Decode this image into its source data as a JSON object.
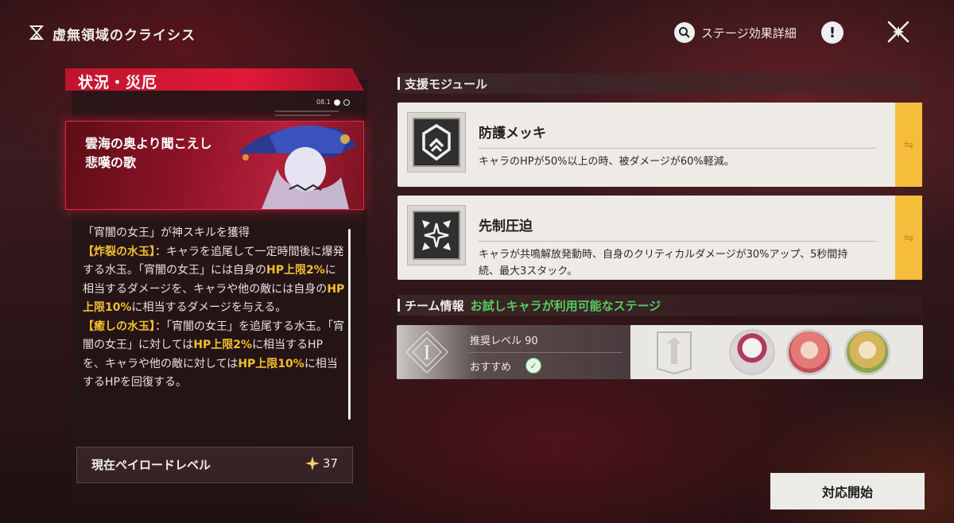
{
  "header": {
    "mode_title": "虚無領域のクライシス",
    "detail_label": "ステージ効果詳細",
    "alert_glyph": "!",
    "icons": {
      "logo": "hourglass-logo-icon",
      "search": "search-icon",
      "alert": "alert-icon",
      "close": "close-icon"
    }
  },
  "left": {
    "section_title": "状況・災厄",
    "stage_number": "08.1",
    "stage_title": "雲海の奥より聞こえし悲嘆の歌",
    "description": [
      [
        {
          "t": "「宵闇の女王」が神スキルを獲得",
          "h": false
        }
      ],
      [
        {
          "t": "【炸裂の水玉】",
          "h": true
        },
        {
          "t": "：キャラを追尾して一定時間後に爆発する水玉。「宵闇の女王」には自身の",
          "h": false
        },
        {
          "t": "HP上限2%",
          "h": true
        },
        {
          "t": "に相当するダメージを、キャラや他の敵には自身の",
          "h": false
        },
        {
          "t": "HP上限10%",
          "h": true
        },
        {
          "t": "に相当するダメージを与える。",
          "h": false
        }
      ],
      [
        {
          "t": "【癒しの水玉】",
          "h": true
        },
        {
          "t": "：「宵闇の女王」を追尾する水玉。「宵闇の女王」に対しては",
          "h": false
        },
        {
          "t": "HP上限2%",
          "h": true
        },
        {
          "t": "に相当するHPを、キャラや他の敵に対しては",
          "h": false
        },
        {
          "t": "HP上限10%",
          "h": true
        },
        {
          "t": "に相当するHPを回復する。",
          "h": false
        }
      ]
    ],
    "payload_label": "現在ペイロードレベル",
    "payload_value": "37"
  },
  "support": {
    "section_title": "支援モジュール",
    "modules": [
      {
        "name": "防護メッキ",
        "desc": "キャラのHPが50%以上の時、被ダメージが60%軽減。",
        "icon": "shield-chevron-icon"
      },
      {
        "name": "先制圧迫",
        "desc": "キャラが共鳴解放発動時、自身のクリティカルダメージが30%アップ、5秒間持続、最大3スタック。",
        "icon": "compass-burst-icon"
      }
    ],
    "swap_glyph": "⇋"
  },
  "team": {
    "section_title": "チーム情報",
    "trial_text": "お試しキャラが利用可能なステージ",
    "roman": "I",
    "recommended_level": "推奨レベル 90",
    "recommend_label": "おすすめ",
    "avatars": [
      "white-haired-character-avatar",
      "pink-haired-character-avatar",
      "blonde-character-avatar"
    ]
  },
  "start_button": "対応開始",
  "colors": {
    "accent_red": "#e01938",
    "highlight": "#f2be2f",
    "trial_green": "#57cc5f",
    "swap_yellow": "#f4bd3c"
  }
}
